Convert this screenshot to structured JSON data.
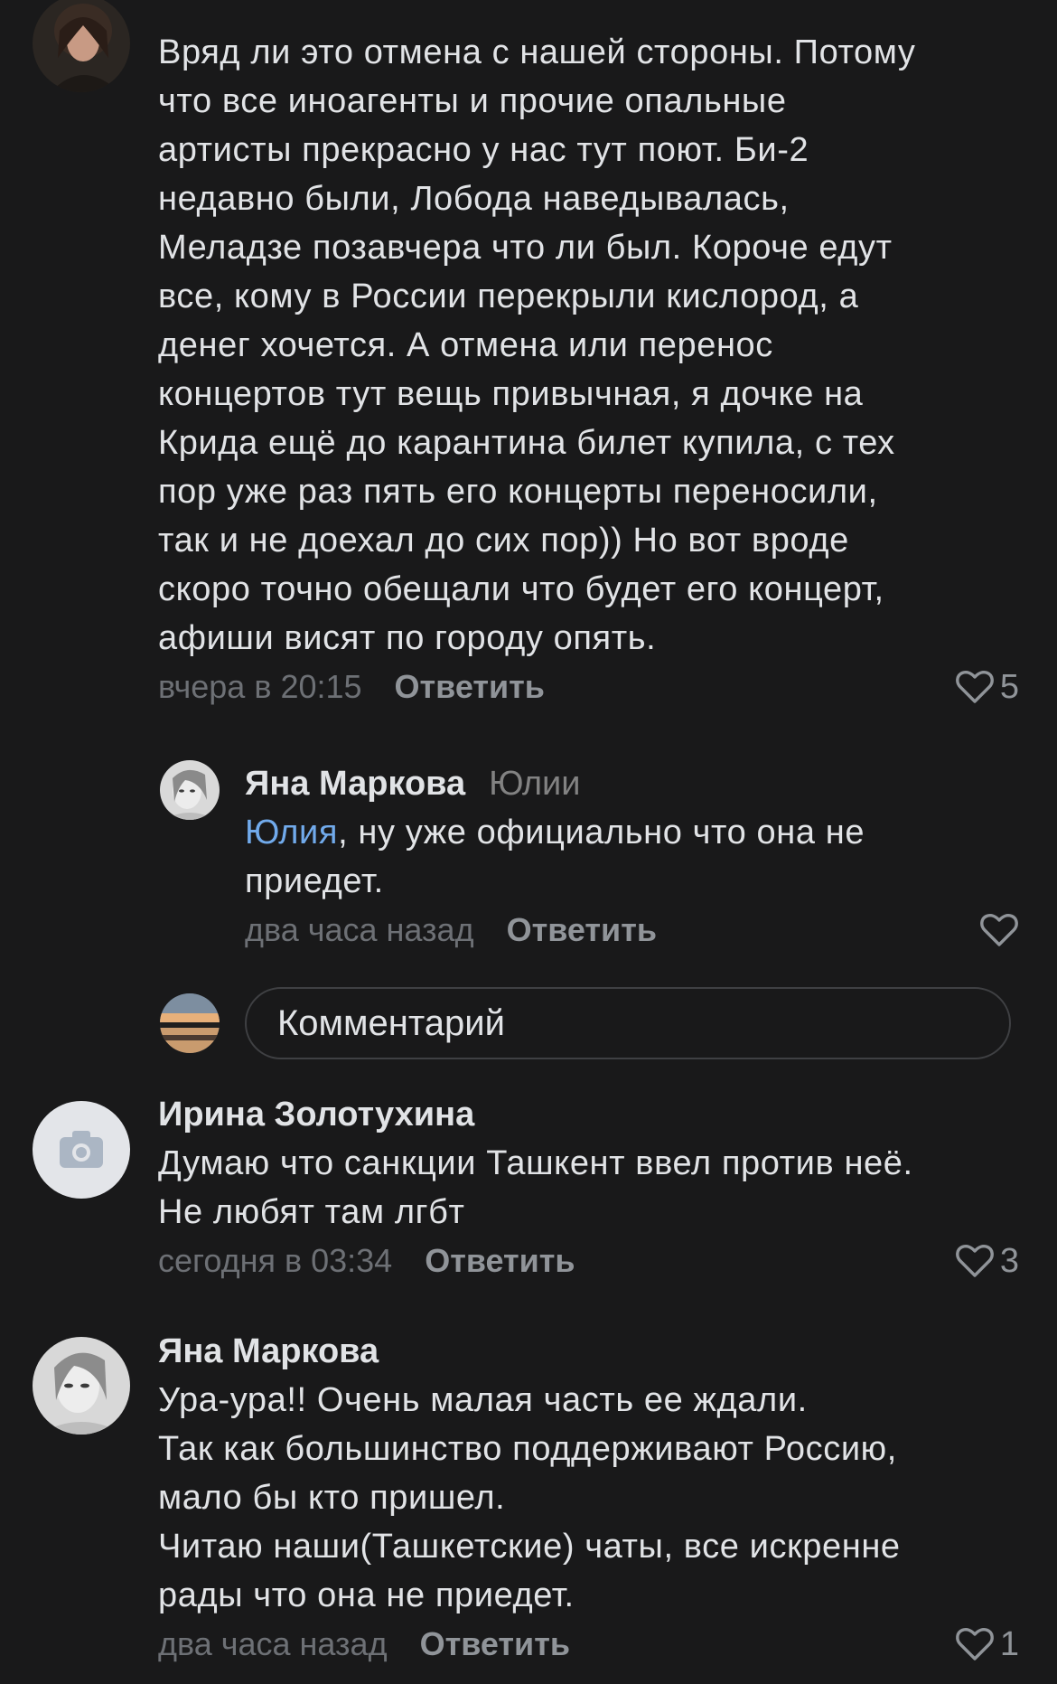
{
  "comments": [
    {
      "text_lines": [
        "Вряд ли это отмена с нашей стороны. Потому",
        "что все иноагенты и прочие опальные",
        "артисты прекрасно у нас тут поют. Би-2",
        "недавно были, Лобода наведывалась,",
        "Меладзе позавчера что ли был. Короче едут",
        "все, кому в России перекрыли кислород, а",
        "денег хочется. А отмена или перенос",
        "концертов тут вещь привычная, я дочке на",
        "Крида ещё до карантина билет купила, с тех",
        "пор уже раз пять его концерты переносили,",
        "так и не доехал до сих пор)) Но вот вроде",
        "скоро точно обещали что будет его концерт,",
        "афиши висят по городу опять."
      ],
      "time": "вчера в 20:15",
      "reply_label": "Ответить",
      "likes": "5"
    },
    {
      "author": "Яна Маркова",
      "reply_to": "Юлии",
      "mention": "Юлия",
      "text_line1_rest": ", ну уже официально что она не",
      "text_line2": "приедет.",
      "time": "два часа назад",
      "reply_label": "Ответить"
    },
    {
      "author": "Ирина Золотухина",
      "text_lines": [
        "Думаю что санкции Ташкент ввел против неё.",
        "Не любят там лгбт"
      ],
      "time": "сегодня в 03:34",
      "reply_label": "Ответить",
      "likes": "3"
    },
    {
      "author": "Яна Маркова",
      "text_lines": [
        "Ура-ура!! Очень малая часть ее ждали.",
        "Так как большинство поддерживают Россию,",
        "мало бы кто пришел.",
        "Читаю наши(Ташкетские) чаты, все искренне",
        "рады что она не приедет."
      ],
      "time": "два часа назад",
      "reply_label": "Ответить",
      "likes": "1"
    }
  ],
  "comment_input": {
    "placeholder": "Комментарий"
  },
  "icons": {
    "like": "heart-outline-icon",
    "no_photo": "camera-icon"
  },
  "colors": {
    "background": "#19191a",
    "text": "#e1e3e6",
    "secondary": "#909499",
    "link": "#71aaeb"
  }
}
